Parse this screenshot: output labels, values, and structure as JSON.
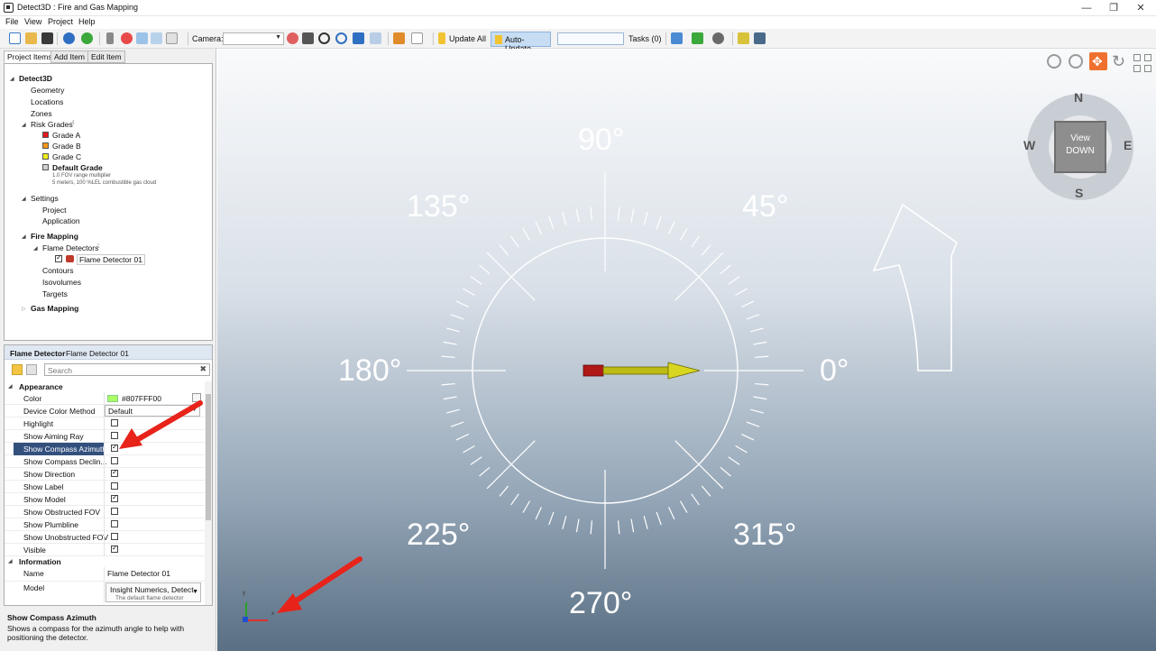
{
  "window": {
    "title": "Detect3D : Fire and Gas Mapping"
  },
  "menu": [
    "File",
    "View",
    "Project",
    "Help"
  ],
  "toolbar": {
    "camera_label": "Camera:",
    "camera_value": "",
    "update_all": "Update All",
    "auto_update": "Auto-Update",
    "tasks": "Tasks (0)"
  },
  "tabs": [
    "Project Items",
    "Add Item",
    "Edit Item"
  ],
  "tree": {
    "root": "Detect3D",
    "geometry": "Geometry",
    "locations": "Locations",
    "zones": "Zones",
    "risk_grades": "Risk Grades",
    "risk_grades_count": "4",
    "grades": [
      {
        "label": "Grade A",
        "color": "#e51a1a"
      },
      {
        "label": "Grade B",
        "color": "#f39a1a"
      },
      {
        "label": "Grade C",
        "color": "#f3f01a"
      }
    ],
    "default_grade": {
      "label": "Default Grade",
      "color": "#d0d0d0",
      "note1": "1.0 FOV range multiplier",
      "note2": "5 meters, 100 %LEL combustible gas cloud"
    },
    "settings": "Settings",
    "project": "Project",
    "application": "Application",
    "fire_mapping": "Fire Mapping",
    "flame_detectors": "Flame Detectors",
    "flame_detectors_count": "1",
    "flame_detector": "Flame Detector 01",
    "contours": "Contours",
    "isovolumes": "Isovolumes",
    "targets": "Targets",
    "gas_mapping": "Gas Mapping"
  },
  "properties": {
    "type": "Flame Detector",
    "name": "Flame Detector 01",
    "search_placeholder": "Search",
    "appearance": "Appearance",
    "information": "Information",
    "color_label": "Color",
    "color_value": "#807FFF00",
    "color_swatch": "#aaff66",
    "device_color_method_label": "Device Color Method",
    "device_color_method_value": "Default",
    "rows": [
      {
        "label": "Highlight",
        "checked": false
      },
      {
        "label": "Show Aiming Ray",
        "checked": false
      },
      {
        "label": "Show Compass Azimuth",
        "checked": true,
        "selected": true
      },
      {
        "label": "Show Compass Declin...",
        "checked": false
      },
      {
        "label": "Show Direction",
        "checked": true
      },
      {
        "label": "Show Label",
        "checked": false
      },
      {
        "label": "Show Model",
        "checked": true
      },
      {
        "label": "Show Obstructed FOV",
        "checked": false
      },
      {
        "label": "Show Plumbline",
        "checked": false
      },
      {
        "label": "Show Unobstructed FOV",
        "checked": false
      },
      {
        "label": "Visible",
        "checked": true
      }
    ],
    "info_name_label": "Name",
    "info_name_value": "Flame Detector 01",
    "info_model_label": "Model",
    "info_model_value": "Insight Numerics, Detect",
    "info_model_sub": "The default flame detector"
  },
  "help": {
    "title": "Show Compass Azimuth",
    "desc": "Shows a compass for the azimuth angle to help with positioning the detector."
  },
  "viewport": {
    "angles": {
      "a90": "90°",
      "a45": "45°",
      "a135": "135°",
      "a180": "180°",
      "a0": "0°",
      "a225": "225°",
      "a315": "315°",
      "a270": "270°"
    },
    "navcube": {
      "n": "N",
      "s": "S",
      "e": "E",
      "w": "W",
      "view": "View",
      "down": "DOWN"
    },
    "axis": {
      "x": "x",
      "y": "y"
    }
  },
  "colors": {
    "accent": "#33507d",
    "arrow_red": "#e8231a",
    "detector_body": "#b8b800"
  }
}
